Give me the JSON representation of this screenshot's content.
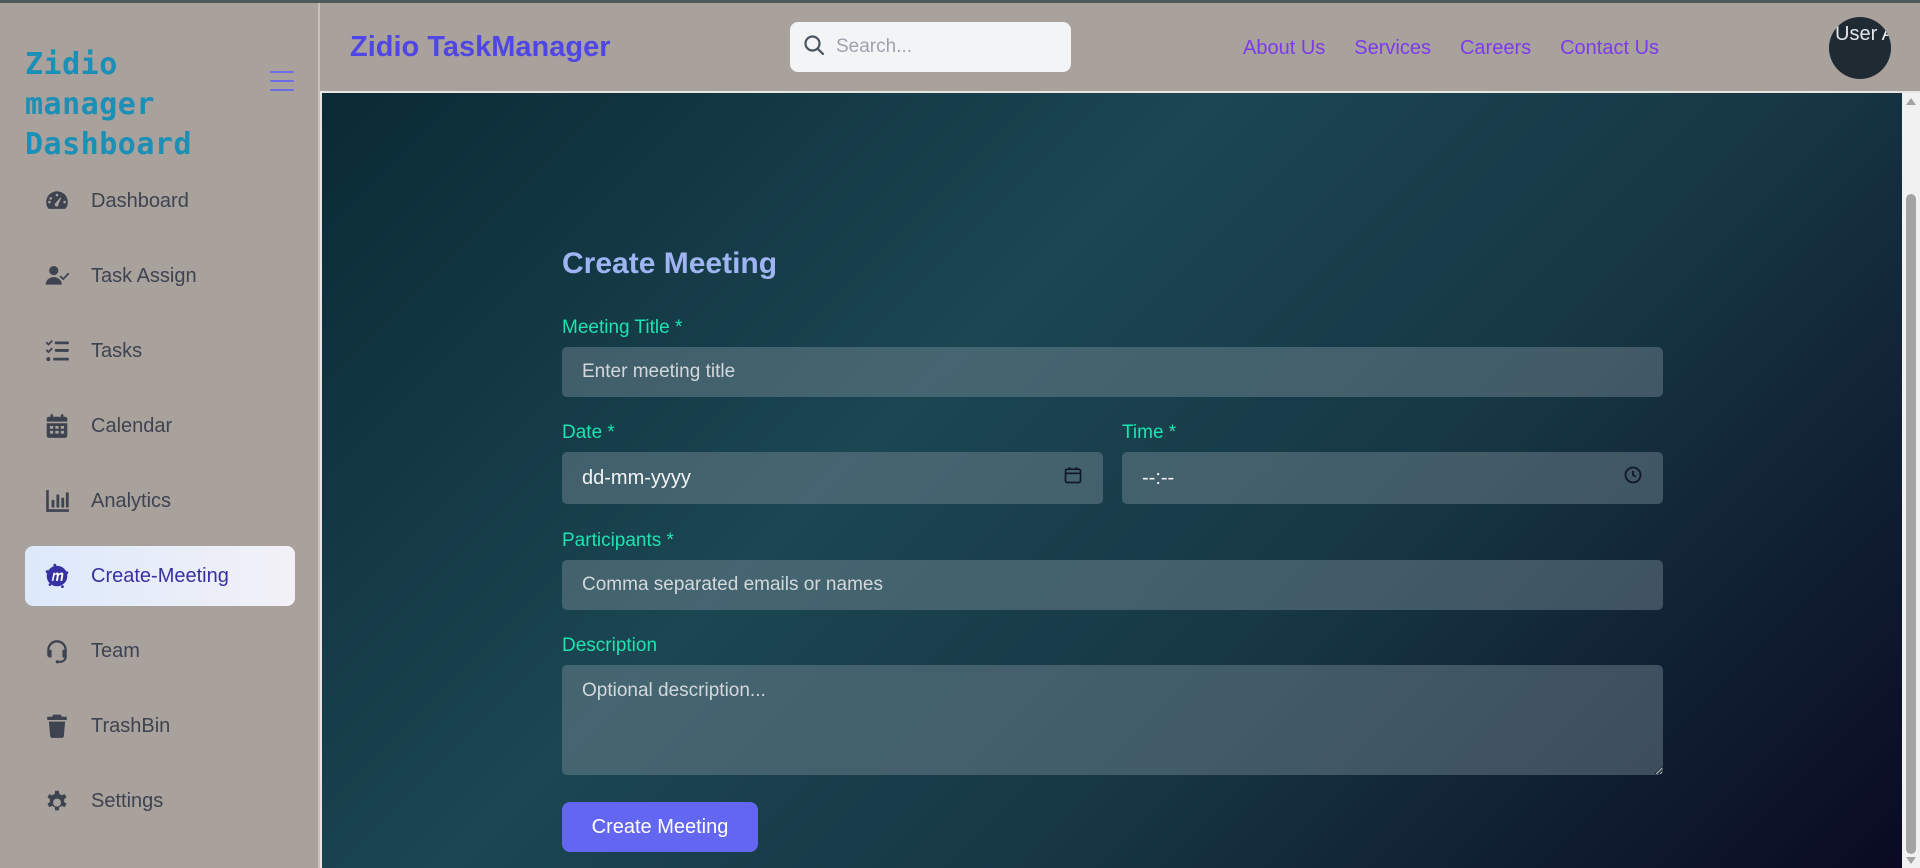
{
  "sidebar": {
    "brand_line1": "Zidio manager",
    "brand_line2": "Dashboard",
    "items": [
      {
        "label": "Dashboard",
        "icon": "gauge-icon"
      },
      {
        "label": "Task Assign",
        "icon": "user-check-icon"
      },
      {
        "label": "Tasks",
        "icon": "list-check-icon"
      },
      {
        "label": "Calendar",
        "icon": "calendar-icon"
      },
      {
        "label": "Analytics",
        "icon": "bar-chart-icon"
      },
      {
        "label": "Create-Meeting",
        "icon": "meetup-icon",
        "active": true
      },
      {
        "label": "Team",
        "icon": "headset-icon"
      },
      {
        "label": "TrashBin",
        "icon": "trash-icon"
      },
      {
        "label": "Settings",
        "icon": "gear-icon"
      }
    ]
  },
  "header": {
    "app_title": "Zidio TaskManager",
    "search_placeholder": "Search...",
    "links": [
      "About Us",
      "Services",
      "Careers",
      "Contact Us"
    ],
    "avatar_alt": "User Avatar"
  },
  "form": {
    "title": "Create Meeting",
    "meeting_title_label": "Meeting Title *",
    "meeting_title_placeholder": "Enter meeting title",
    "date_label": "Date *",
    "date_value": "dd-mm-yyyy",
    "time_label": "Time *",
    "time_value": "--:--",
    "participants_label": "Participants *",
    "participants_placeholder": "Comma separated emails or names",
    "description_label": "Description",
    "description_placeholder": "Optional description...",
    "submit_label": "Create Meeting"
  },
  "colors": {
    "brand": "#1b8fb5",
    "app_title": "#4f46e5",
    "link": "#7c3aed",
    "label": "#1ee3b0",
    "form_title": "#9fb4f3",
    "button": "#6366f1"
  }
}
